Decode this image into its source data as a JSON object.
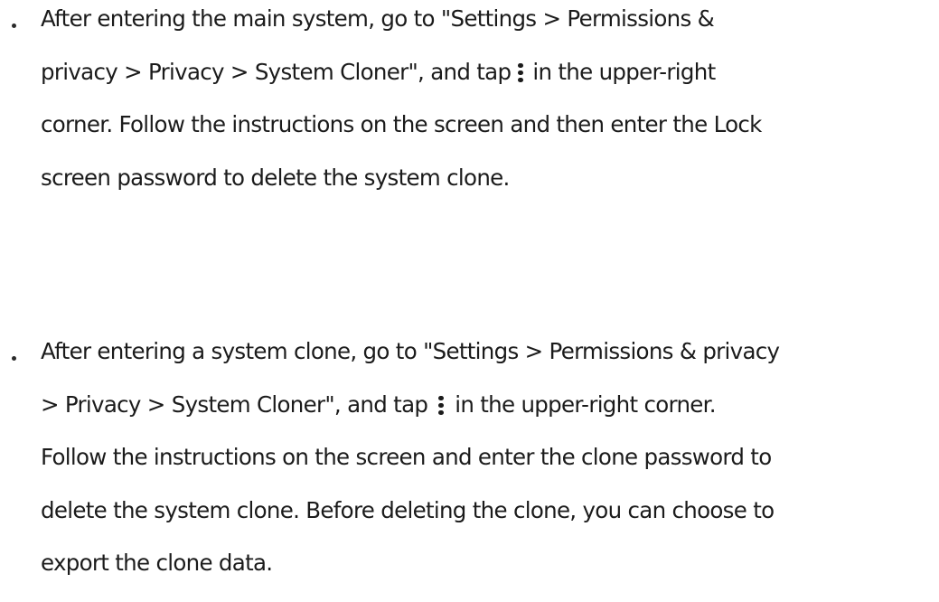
{
  "items": [
    {
      "lines": [
        "After entering the main system, go to \"Settings > Permissions &",
        {
          "before": "privacy > Privacy > System Cloner\", and tap",
          "icon": "more-vertical-icon",
          "after": "in the upper-right"
        },
        "corner. Follow the instructions on the screen and then enter the Lock",
        "screen password to delete the system clone."
      ]
    },
    {
      "lines": [
        "After entering a system clone, go to \"Settings > Permissions & privacy",
        {
          "before": "> Privacy > System Cloner\", and tap",
          "icon": "more-vertical-icon",
          "after": "in the upper-right corner."
        },
        "Follow the instructions on the screen and enter the clone password to",
        "delete the system clone. Before deleting the clone, you can choose to",
        "export the clone data."
      ]
    }
  ]
}
